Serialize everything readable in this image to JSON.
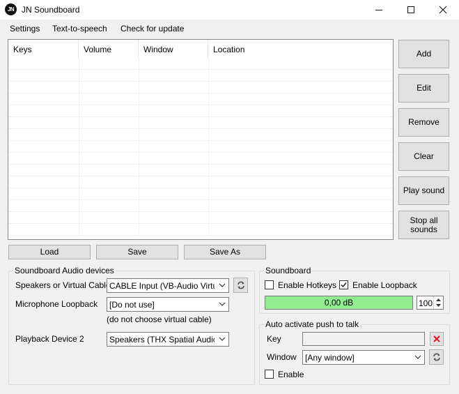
{
  "window": {
    "icon_text": "JN",
    "title": "JN Soundboard"
  },
  "menu": {
    "items": [
      "Settings",
      "Text-to-speech",
      "Check for update"
    ]
  },
  "list": {
    "columns": [
      "Keys",
      "Volume",
      "Window",
      "Location"
    ],
    "rows": []
  },
  "side_buttons": {
    "add": "Add",
    "edit": "Edit",
    "remove": "Remove",
    "clear": "Clear",
    "play": "Play sound",
    "stop_line1": "Stop all",
    "stop_line2": "sounds"
  },
  "file_buttons": {
    "load": "Load",
    "save": "Save",
    "save_as": "Save As"
  },
  "audio_devices": {
    "legend": "Soundboard Audio devices",
    "speakers_label": "Speakers or Virtual Cable",
    "speakers_value": "CABLE Input (VB-Audio Virtual C",
    "mic_label": "Microphone Loopback",
    "mic_value": "[Do not use]",
    "mic_note": "(do not choose virtual cable)",
    "playback2_label": "Playback Device 2",
    "playback2_value": "Speakers (THX Spatial Audio)"
  },
  "soundboard": {
    "legend": "Soundboard",
    "enable_hotkeys_label": "Enable Hotkeys",
    "enable_hotkeys_checked": false,
    "enable_loopback_label": "Enable Loopback",
    "enable_loopback_checked": true,
    "level_text": "0,00 dB",
    "level_color": "#90ee90",
    "volume_value": "100"
  },
  "push_to_talk": {
    "legend": "Auto activate push to talk",
    "key_label": "Key",
    "key_value": "",
    "window_label": "Window",
    "window_value": "[Any window]",
    "enable_label": "Enable",
    "enable_checked": false,
    "clear_icon": "red-x-icon",
    "refresh_icon": "refresh-icon"
  },
  "colors": {
    "clear_key_x": "#e81123",
    "meter_green": "#90ee90",
    "refresh_blue": "#2a6db8"
  }
}
